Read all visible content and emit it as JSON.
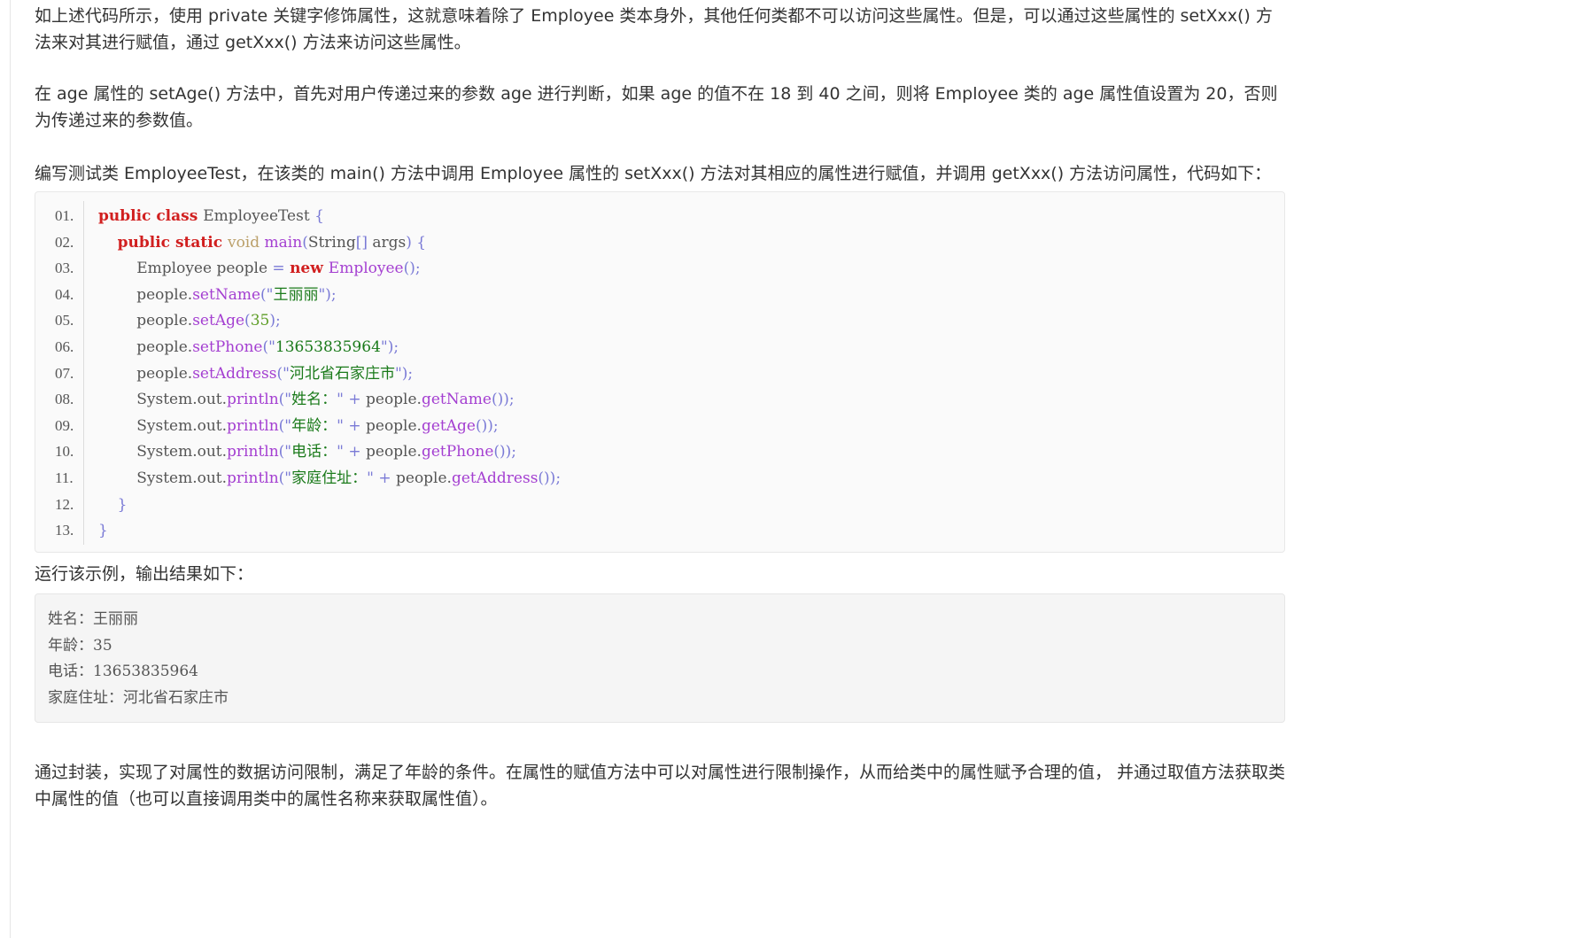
{
  "paragraphs": {
    "p1": "如上述代码所示，使用 private 关键字修饰属性，这就意味着除了 Employee 类本身外，其他任何类都不可以访问这些属性。但是，可以通过这些属性的 setXxx() 方法来对其进行赋值，通过 getXxx() 方法来访问这些属性。",
    "p2": "在 age 属性的 setAge() 方法中，首先对用户传递过来的参数 age 进行判断，如果 age 的值不在 18 到 40 之间，则将 Employee 类的 age 属性值设置为 20，否则为传递过来的参数值。",
    "p3": "编写测试类 EmployeeTest，在该类的 main() 方法中调用 Employee 属性的 setXxx() 方法对其相应的属性进行赋值，并调用 getXxx() 方法访问属性，代码如下：",
    "p4": "运行该示例，输出结果如下：",
    "p5": "通过封装，实现了对属性的数据访问限制，满足了年龄的条件。在属性的赋值方法中可以对属性进行限制操作，从而给类中的属性赋予合理的值， 并通过取值方法获取类中属性的值（也可以直接调用类中的属性名称来获取属性值）。"
  },
  "code": {
    "line_numbers": [
      "01.",
      "02.",
      "03.",
      "04.",
      "05.",
      "06.",
      "07.",
      "08.",
      "09.",
      "10.",
      "11.",
      "12.",
      "13."
    ],
    "lines": [
      [
        [
          "kw",
          "public class "
        ],
        [
          "pl",
          "EmployeeTest "
        ],
        [
          "pu",
          "{"
        ]
      ],
      [
        [
          "pl",
          "    "
        ],
        [
          "kw",
          "public static "
        ],
        [
          "ty",
          "void "
        ],
        [
          "fn",
          "main"
        ],
        [
          "pu",
          "("
        ],
        [
          "pl",
          "String"
        ],
        [
          "pu",
          "[] "
        ],
        [
          "pl",
          "args"
        ],
        [
          "pu",
          ") {"
        ]
      ],
      [
        [
          "pl",
          "        Employee people "
        ],
        [
          "pu",
          "= "
        ],
        [
          "kw",
          "new "
        ],
        [
          "fn",
          "Employee"
        ],
        [
          "pu",
          "();"
        ]
      ],
      [
        [
          "pl",
          "        people."
        ],
        [
          "fn",
          "setName"
        ],
        [
          "pu",
          "(\""
        ],
        [
          "st",
          "王丽丽"
        ],
        [
          "pu",
          "\");"
        ]
      ],
      [
        [
          "pl",
          "        people."
        ],
        [
          "fn",
          "setAge"
        ],
        [
          "pu",
          "("
        ],
        [
          "nm",
          "35"
        ],
        [
          "pu",
          ");"
        ]
      ],
      [
        [
          "pl",
          "        people."
        ],
        [
          "fn",
          "setPhone"
        ],
        [
          "pu",
          "(\""
        ],
        [
          "st",
          "13653835964"
        ],
        [
          "pu",
          "\");"
        ]
      ],
      [
        [
          "pl",
          "        people."
        ],
        [
          "fn",
          "setAddress"
        ],
        [
          "pu",
          "(\""
        ],
        [
          "st",
          "河北省石家庄市"
        ],
        [
          "pu",
          "\");"
        ]
      ],
      [
        [
          "pl",
          "        System.out."
        ],
        [
          "fn",
          "println"
        ],
        [
          "pu",
          "(\""
        ],
        [
          "st",
          "姓名："
        ],
        [
          "pu",
          "\" + "
        ],
        [
          "pl",
          "people."
        ],
        [
          "fn",
          "getName"
        ],
        [
          "pu",
          "());"
        ]
      ],
      [
        [
          "pl",
          "        System.out."
        ],
        [
          "fn",
          "println"
        ],
        [
          "pu",
          "(\""
        ],
        [
          "st",
          "年龄："
        ],
        [
          "pu",
          "\" + "
        ],
        [
          "pl",
          "people."
        ],
        [
          "fn",
          "getAge"
        ],
        [
          "pu",
          "());"
        ]
      ],
      [
        [
          "pl",
          "        System.out."
        ],
        [
          "fn",
          "println"
        ],
        [
          "pu",
          "(\""
        ],
        [
          "st",
          "电话："
        ],
        [
          "pu",
          "\" + "
        ],
        [
          "pl",
          "people."
        ],
        [
          "fn",
          "getPhone"
        ],
        [
          "pu",
          "());"
        ]
      ],
      [
        [
          "pl",
          "        System.out."
        ],
        [
          "fn",
          "println"
        ],
        [
          "pu",
          "(\""
        ],
        [
          "st",
          "家庭住址："
        ],
        [
          "pu",
          "\" + "
        ],
        [
          "pl",
          "people."
        ],
        [
          "fn",
          "getAddress"
        ],
        [
          "pu",
          "());"
        ]
      ],
      [
        [
          "pu",
          "    }"
        ]
      ],
      [
        [
          "pu",
          "}"
        ]
      ]
    ]
  },
  "output": {
    "lines": [
      "姓名：王丽丽",
      "年龄：35",
      "电话：13653835964",
      "家庭住址：河北省石家庄市"
    ]
  }
}
